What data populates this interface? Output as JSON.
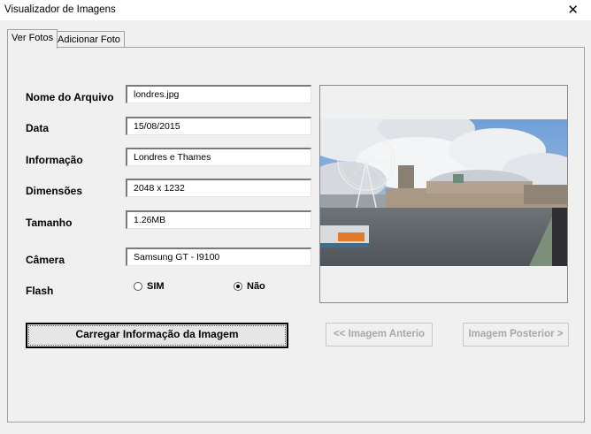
{
  "window": {
    "title": "Visualizador de Imagens",
    "close_glyph": "✕"
  },
  "tabs": [
    {
      "label": "Ver Fotos",
      "active": true
    },
    {
      "label": "Adicionar Foto",
      "active": false
    }
  ],
  "form": {
    "file_name": {
      "label": "Nome do Arquivo",
      "value": "londres.jpg"
    },
    "date": {
      "label": "Data",
      "value": "15/08/2015"
    },
    "info": {
      "label": "Informação",
      "value": "Londres e Thames"
    },
    "dimensions": {
      "label": "Dimensões",
      "value": "2048 x 1232"
    },
    "size": {
      "label": "Tamanho",
      "value": "1.26MB"
    },
    "camera": {
      "label": "Câmera",
      "value": "Samsung GT - I9100"
    },
    "flash": {
      "label": "Flash",
      "option_yes": "SIM",
      "option_no": "Não",
      "selected": "Não"
    }
  },
  "buttons": {
    "load": "Carregar Informação da Imagem",
    "previous": "<< Imagem Anterio",
    "next": "Imagem Posterior >"
  }
}
